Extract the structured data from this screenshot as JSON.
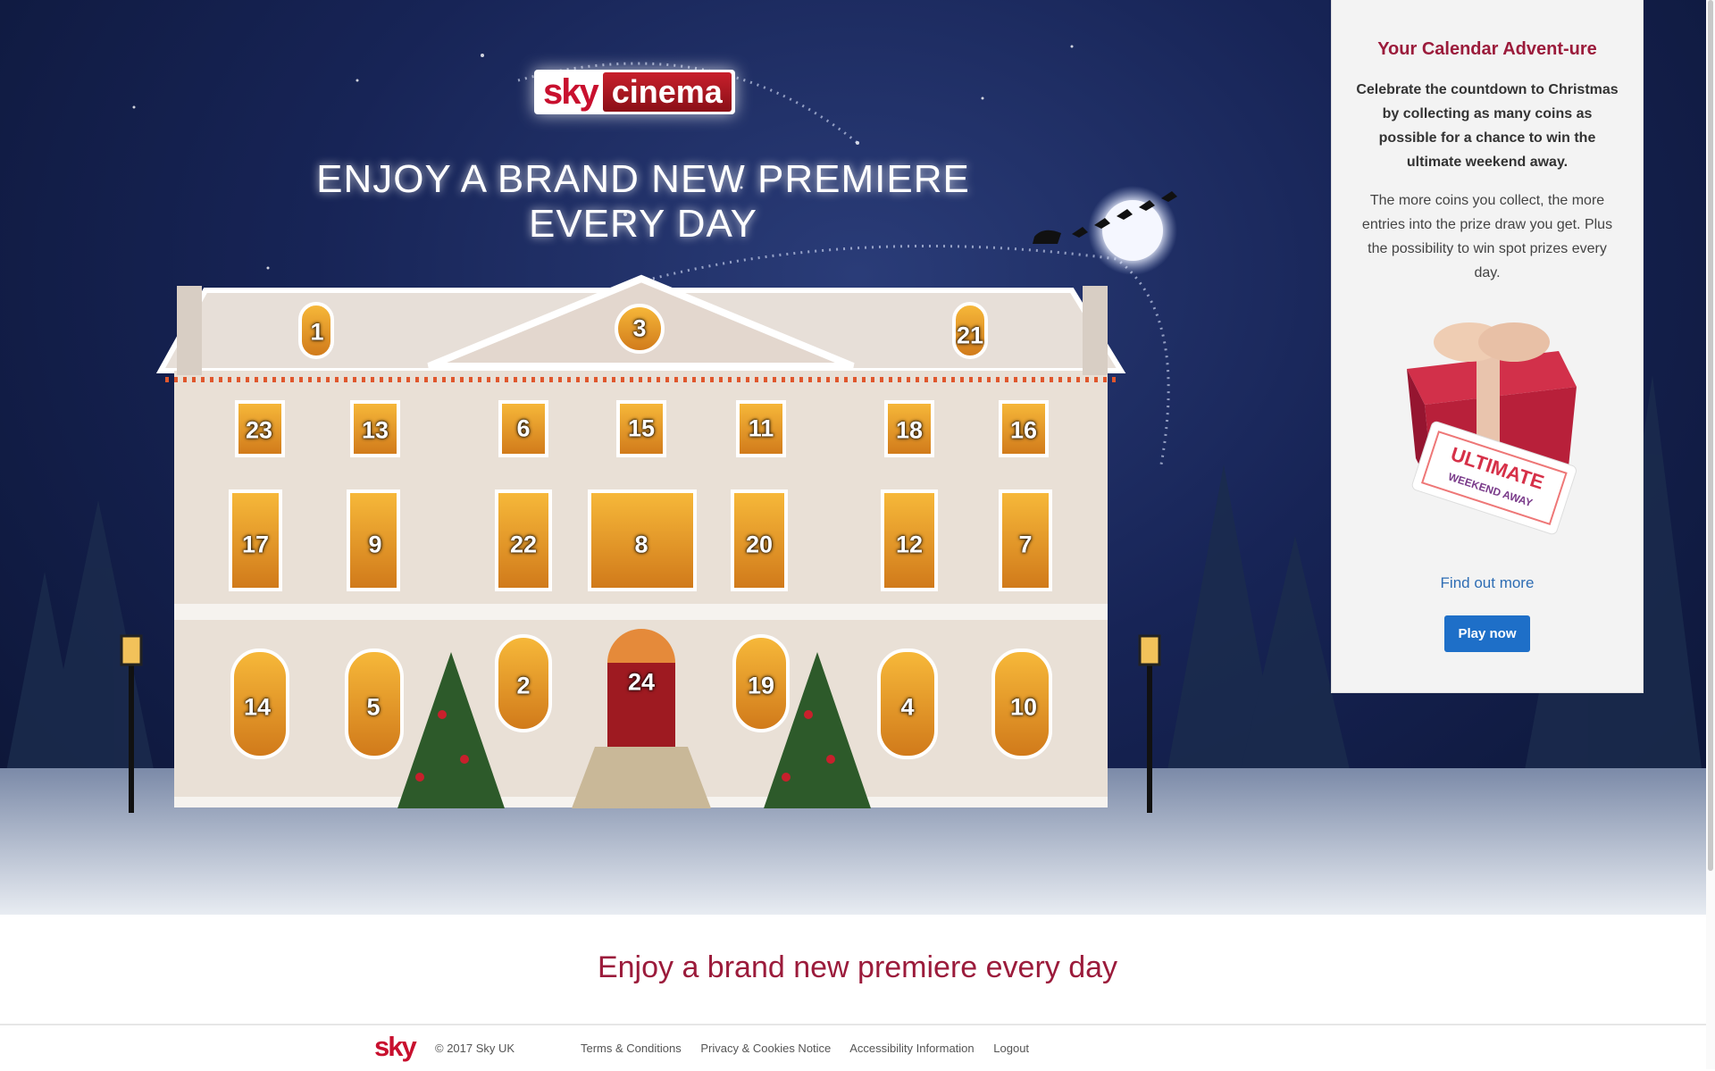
{
  "hero": {
    "logo_sky": "sky",
    "logo_cinema": "cinema",
    "headline": "ENJOY A BRAND NEW PREMIERE EVERY DAY",
    "doors": [
      "1",
      "3",
      "21",
      "23",
      "13",
      "6",
      "15",
      "11",
      "18",
      "16",
      "17",
      "9",
      "22",
      "8",
      "20",
      "12",
      "7",
      "14",
      "5",
      "2",
      "24",
      "19",
      "4",
      "10"
    ]
  },
  "panel": {
    "title": "Your Calendar Advent-ure",
    "intro": "Celebrate the countdown to Christmas by collecting as many coins as possible for a chance to win the ultimate weekend away.",
    "body": "The more coins you collect, the more entries into the prize draw you get. Plus the possibility to win spot prizes every day.",
    "ticket_line1": "ULTIMATE",
    "ticket_line2": "WEEKEND AWAY",
    "find_out_more": "Find out more",
    "play_now": "Play now"
  },
  "tagline": "Enjoy a brand new premiere every day",
  "footer": {
    "logo": "sky",
    "copyright": "© 2017 Sky UK",
    "links": [
      "Terms & Conditions",
      "Privacy & Cookies Notice",
      "Accessibility Information",
      "Logout"
    ]
  },
  "colors": {
    "brand_red": "#9b1b3b",
    "link_blue": "#2e6db4",
    "button_blue": "#1e6fc8"
  }
}
